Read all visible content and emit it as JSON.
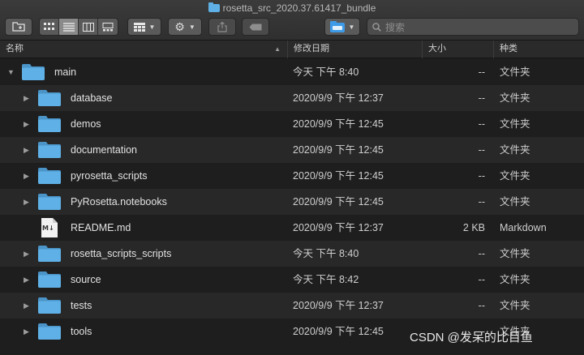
{
  "window": {
    "title": "rosetta_src_2020.37.61417_bundle"
  },
  "toolbar": {
    "back_icon": "new-folder-icon",
    "view_icon": "icon-view-icon",
    "list_icon": "list-view-icon",
    "column_icon": "column-view-icon",
    "gallery_icon": "gallery-view-icon",
    "group_icon": "group-grid-icon",
    "action_icon": "gear-icon",
    "share_icon": "share-icon",
    "tag_icon": "tag-icon",
    "location_icon": "folder-location-icon",
    "search_placeholder": "搜索"
  },
  "columns": {
    "name": "名称",
    "date": "修改日期",
    "size": "大小",
    "kind": "种类"
  },
  "rows": [
    {
      "name": "main",
      "date": "今天 下午 8:40",
      "size": "--",
      "kind": "文件夹",
      "icon": "folder",
      "expanded": true,
      "level": 0
    },
    {
      "name": "database",
      "date": "2020/9/9 下午 12:37",
      "size": "--",
      "kind": "文件夹",
      "icon": "folder",
      "expanded": false,
      "level": 1
    },
    {
      "name": "demos",
      "date": "2020/9/9 下午 12:45",
      "size": "--",
      "kind": "文件夹",
      "icon": "folder",
      "expanded": false,
      "level": 1
    },
    {
      "name": "documentation",
      "date": "2020/9/9 下午 12:45",
      "size": "--",
      "kind": "文件夹",
      "icon": "folder",
      "expanded": false,
      "level": 1
    },
    {
      "name": "pyrosetta_scripts",
      "date": "2020/9/9 下午 12:45",
      "size": "--",
      "kind": "文件夹",
      "icon": "folder",
      "expanded": false,
      "level": 1
    },
    {
      "name": "PyRosetta.notebooks",
      "date": "2020/9/9 下午 12:45",
      "size": "--",
      "kind": "文件夹",
      "icon": "folder",
      "expanded": false,
      "level": 1
    },
    {
      "name": "README.md",
      "date": "2020/9/9 下午 12:37",
      "size": "2 KB",
      "kind": "Markdown",
      "icon": "markdown",
      "expanded": null,
      "level": 1
    },
    {
      "name": "rosetta_scripts_scripts",
      "date": "今天 下午 8:40",
      "size": "--",
      "kind": "文件夹",
      "icon": "folder",
      "expanded": false,
      "level": 1
    },
    {
      "name": "source",
      "date": "今天 下午 8:42",
      "size": "--",
      "kind": "文件夹",
      "icon": "folder",
      "expanded": false,
      "level": 1
    },
    {
      "name": "tests",
      "date": "2020/9/9 下午 12:37",
      "size": "--",
      "kind": "文件夹",
      "icon": "folder",
      "expanded": false,
      "level": 1
    },
    {
      "name": "tools",
      "date": "2020/9/9 下午 12:45",
      "size": "--",
      "kind": "文件夹",
      "icon": "folder",
      "expanded": false,
      "level": 1
    }
  ],
  "markdown_badge": "M↓",
  "watermark": "CSDN @发呆的比目鱼",
  "colors": {
    "folder": "#5fb0e6",
    "background": "#1e1e1e",
    "row_alt": "#282828"
  }
}
